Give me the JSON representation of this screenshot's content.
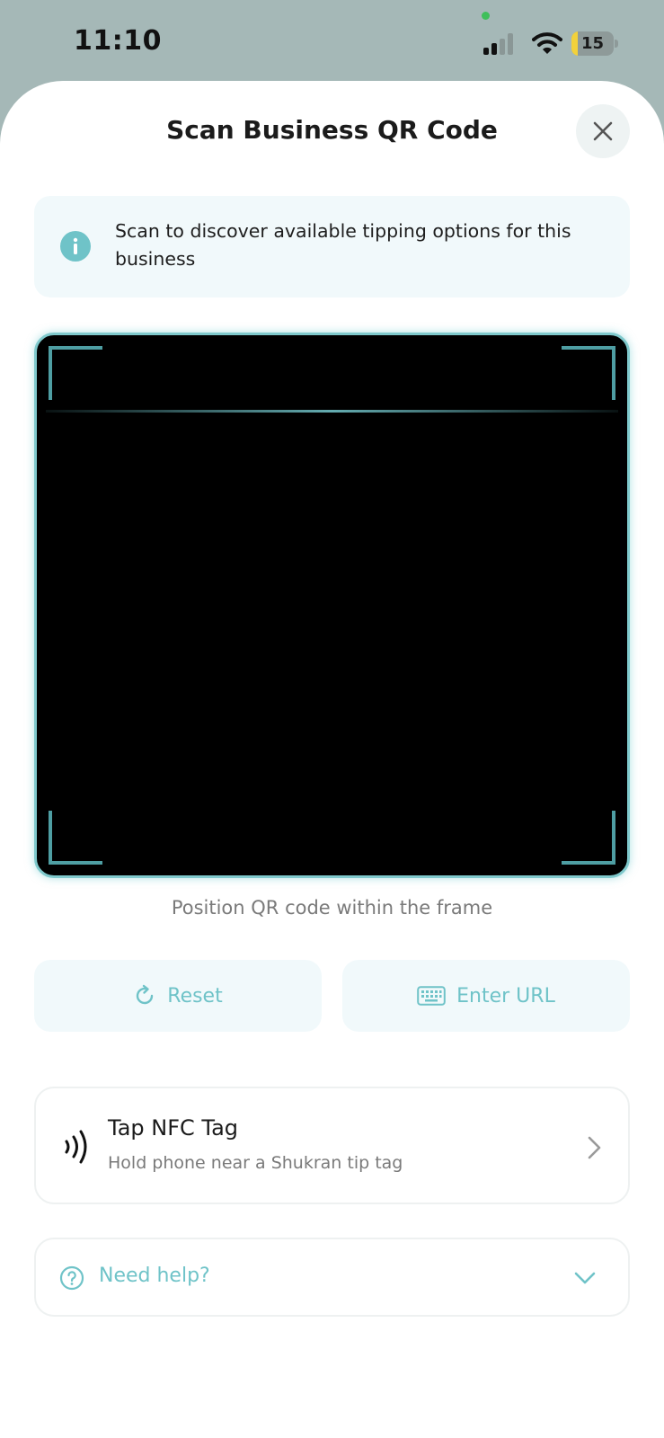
{
  "status_bar": {
    "time": "11:10",
    "battery_level": "15",
    "battery_fraction": 0.15
  },
  "header": {
    "title": "Scan Business QR Code",
    "close_icon": "close-icon"
  },
  "info": {
    "icon": "info-icon",
    "text": "Scan to discover available tipping options for this business"
  },
  "scanner": {
    "hint": "Position QR code within the frame"
  },
  "actions": {
    "reset_label": "Reset",
    "reset_icon": "refresh-icon",
    "enter_url_label": "Enter URL",
    "enter_url_icon": "keyboard-icon"
  },
  "nfc": {
    "title": "Tap NFC Tag",
    "subtitle": "Hold phone near a Shukran tip tag",
    "icon": "nfc-icon"
  },
  "help": {
    "label": "Need help?",
    "icon": "question-circle-icon"
  },
  "colors": {
    "accent": "#6fc3c8",
    "frame_border": "#7fc9cc",
    "corner": "#4e9ea3",
    "card_bg": "#f1f9fb"
  }
}
